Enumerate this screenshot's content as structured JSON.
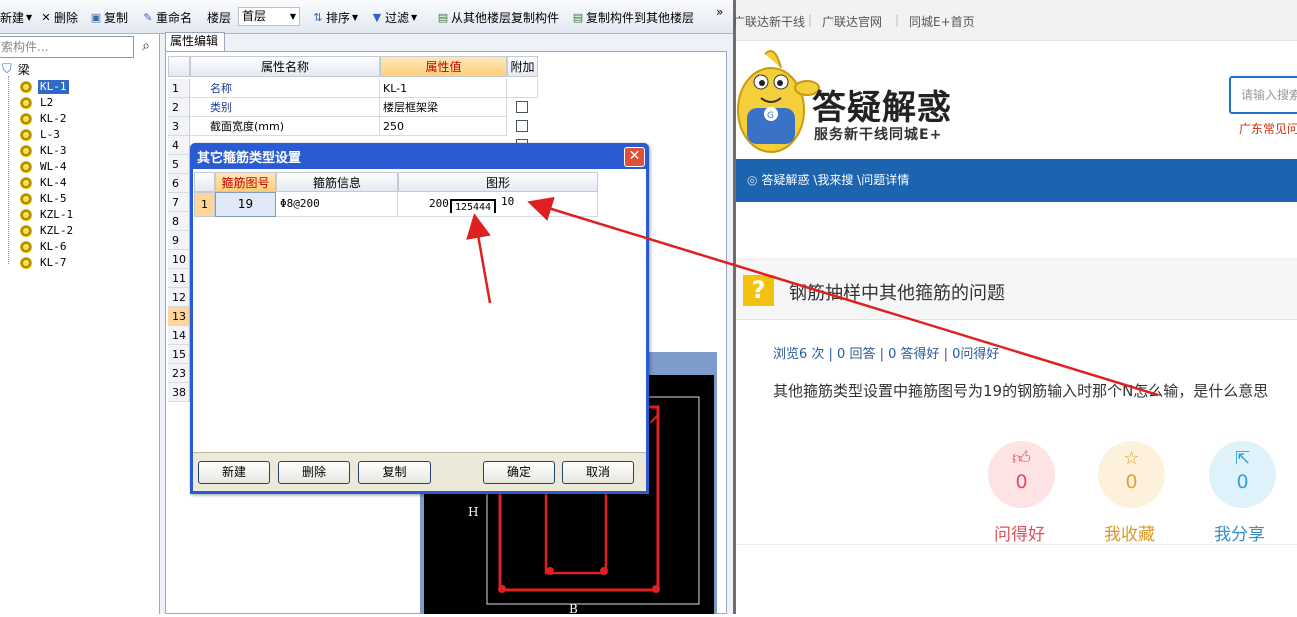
{
  "toolbar": {
    "items": [
      "新建",
      "删除",
      "复制",
      "重命名",
      "楼层",
      "排序",
      "过滤",
      "从其他楼层复制构件",
      "复制构件到其他楼层",
      "»"
    ],
    "floor_value": "首层"
  },
  "tree": {
    "search_placeholder": "索构件...",
    "root_label": "梁",
    "items": [
      "KL-1",
      "L2",
      "KL-2",
      "L-3",
      "KL-3",
      "WL-4",
      "KL-4",
      "KL-5",
      "KZL-1",
      "KZL-2",
      "KL-6",
      "KL-7"
    ]
  },
  "props": {
    "tab_label": "属性编辑",
    "col_name": "属性名称",
    "col_value": "属性值",
    "col_extra": "附加",
    "row_numbers": [
      "1",
      "2",
      "3",
      "4",
      "5",
      "6",
      "7",
      "8",
      "9",
      "10",
      "11",
      "12",
      "13",
      "14",
      "15",
      "23",
      "38"
    ],
    "rows": [
      {
        "name": "名称",
        "value": "KL-1"
      },
      {
        "name": "类别",
        "value": "楼层框架梁"
      },
      {
        "name": "截面宽度(mm)",
        "value": "250"
      }
    ]
  },
  "dialog": {
    "title": "其它箍筋类型设置",
    "close_label": "✕",
    "col_figure_no": "箍筋图号",
    "col_info": "箍筋信息",
    "col_shape": "图形",
    "row_index": "1",
    "figure_no": "19",
    "info": "Φ8@200",
    "shape_left": "200",
    "shape_box": "125444",
    "shape_right": "10",
    "buttons": {
      "new": "新建",
      "delete": "删除",
      "copy": "复制",
      "ok": "确定",
      "cancel": "取消"
    }
  },
  "drawing": {
    "label_h": "H",
    "label_b": "B"
  },
  "web": {
    "top_links": [
      "广联达新干线",
      "广联达官网",
      "同城E+首页"
    ],
    "brand_title": "答疑解惑",
    "brand_sub": "服务新干线同城E+",
    "search_placeholder": "请输入搜索",
    "hot_text": "广东常见问",
    "breadcrumb": "答疑解惑 \\我来搜 \\问题详情",
    "question_icon": "?",
    "question_title": "钢筋抽样中其他箍筋的问题",
    "stats": "浏览6 次 | 0 回答 | 0 答得好 | 0问得好",
    "question_body": "其他箍筋类型设置中箍筋图号为19的钢筋输入时那个N怎么输，是什么意思",
    "actions": [
      {
        "count": "0",
        "label": "问得好",
        "icon": "thumbs-up-icon",
        "bg": "#fde3e3",
        "fg": "#e0505a"
      },
      {
        "count": "0",
        "label": "我收藏",
        "icon": "star-icon",
        "bg": "#fdf1dc",
        "fg": "#e2a43a"
      },
      {
        "count": "0",
        "label": "我分享",
        "icon": "share-icon",
        "bg": "#dff2fb",
        "fg": "#3aa0d8"
      }
    ]
  },
  "colors": {
    "dialog_title_bar": "#2b5bd2",
    "web_bar": "#1c63b0",
    "annotation_arrow": "#e02020"
  }
}
